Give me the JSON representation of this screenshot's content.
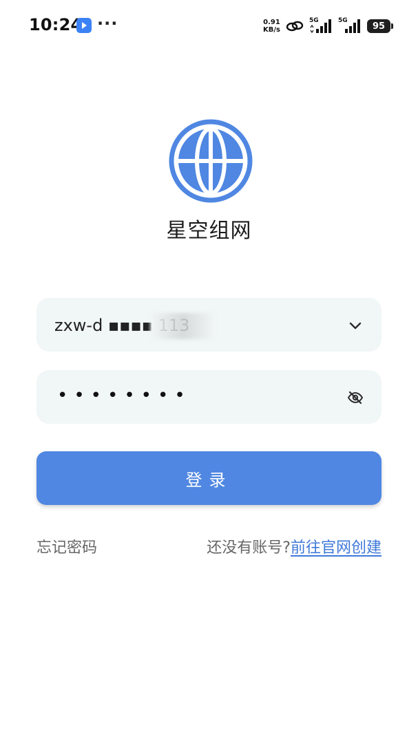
{
  "status_bar": {
    "time": "10:24",
    "more": "···",
    "net_speed_value": "0.91",
    "net_speed_unit": "KB/s",
    "signal_1_label": "5G",
    "signal_2_label": "5G",
    "battery": "95"
  },
  "app": {
    "name": "星空组网",
    "logo_icon": "globe-icon"
  },
  "account": {
    "value": "zxw-d  ▪▪▪▪  113",
    "dropdown_icon": "chevron-down-icon"
  },
  "password": {
    "masked_value": "••••••••",
    "toggle_icon": "eye-off-icon"
  },
  "login": {
    "label": "登录"
  },
  "links": {
    "forgot_password": "忘记密码",
    "no_account": "还没有账号?",
    "register_link": "前往官网创建"
  },
  "colors": {
    "primary": "#4f87e2",
    "link": "#3e78d9",
    "field_bg": "#f1f6f6"
  }
}
